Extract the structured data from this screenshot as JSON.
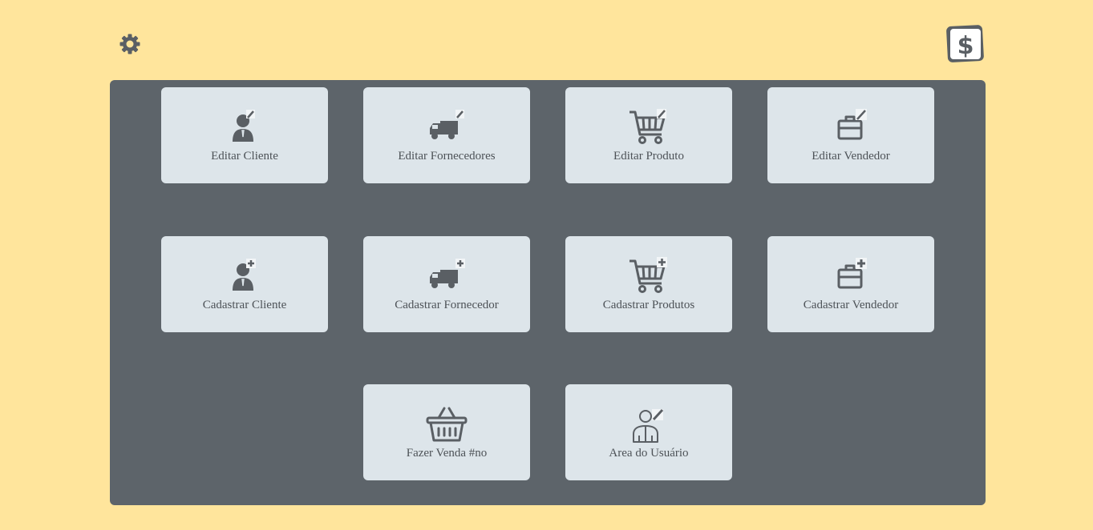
{
  "header": {
    "settings_icon": "gear-icon",
    "finance_icon": "dollar-icon"
  },
  "colors": {
    "background": "#ffe59c",
    "panel": "#5d646a",
    "card": "#dde5ea",
    "text": "#4d5257",
    "icon": "#5a5f64"
  },
  "menu": {
    "row1": [
      {
        "label": "Editar Cliente",
        "icon": "edit-client-icon"
      },
      {
        "label": "Editar Fornecedores",
        "icon": "edit-supplier-truck-icon"
      },
      {
        "label": "Editar Produto",
        "icon": "edit-product-cart-icon"
      },
      {
        "label": "Editar Vendedor",
        "icon": "edit-seller-briefcase-icon"
      }
    ],
    "row2": [
      {
        "label": "Cadastrar Cliente",
        "icon": "add-client-icon"
      },
      {
        "label": "Cadastrar Fornecedor",
        "icon": "add-supplier-truck-icon"
      },
      {
        "label": "Cadastrar Produtos",
        "icon": "add-product-cart-icon"
      },
      {
        "label": "Cadastrar Vendedor",
        "icon": "add-seller-briefcase-icon"
      }
    ],
    "row3": [
      {
        "label": "Fazer Venda #no",
        "icon": "basket-icon"
      },
      {
        "label": "Area do Usuário",
        "icon": "user-edit-icon"
      }
    ]
  }
}
